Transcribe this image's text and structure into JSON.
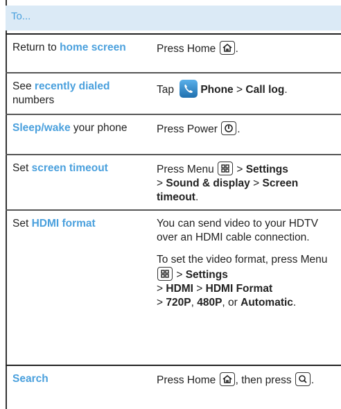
{
  "header": {
    "text": "To..."
  },
  "rows": {
    "r1": {
      "a_kw": "Return to home screen",
      "b_pre": "Press Home",
      "b_post": "."
    },
    "r2": {
      "a_pre": "See",
      "a_kw": "recently dialed",
      "a_post": "numbers",
      "b_pre": "Tap",
      "b_bold1": "Phone",
      "b_sep": ">",
      "b_bold2": "Call log",
      "b_post": "."
    },
    "r3": {
      "a_kw": "Sleep/wake",
      "a_post": "your phone",
      "b_pre": "Press Power",
      "b_post": "."
    },
    "r4": {
      "a_pre": "Set",
      "a_kw": "screen timeout",
      "b_pre": "Press Menu",
      "b_sep1": ">",
      "b_bold1": "Settings",
      "b_sep2": ">",
      "b_bold2": "Sound & display",
      "b_sep3": ">",
      "b_bold3": "Screen timeout",
      "b_post": "."
    },
    "r5": {
      "a_pre": "Set",
      "a_kw": "HDMI format",
      "b_p1": "You can send video to your HDTV over an HDMI cable connection.",
      "b_p2_pre": "To set the video format, press Menu",
      "b_sep1": ">",
      "b_bold1": "Settings",
      "b_sep2": ">",
      "b_bold2": "HDMI",
      "b_sep3": ">",
      "b_bold3": "HDMI Format",
      "b_sep4": ">",
      "b_bold4": "720P",
      "b_comma": ",",
      "b_bold5": "480P",
      "b_or": ", or",
      "b_bold6": "Automatic",
      "b_post": "."
    },
    "r6": {
      "a_kw": "Search",
      "b_pre": "Press Home",
      "b_mid": ", then press",
      "b_post": "."
    }
  },
  "colors": {
    "accent": "#4aa0dd",
    "header_bg": "#dbeaf6"
  },
  "icons": [
    "home-key-icon",
    "phone-app-icon",
    "power-key-icon",
    "menu-key-icon",
    "search-key-icon"
  ]
}
